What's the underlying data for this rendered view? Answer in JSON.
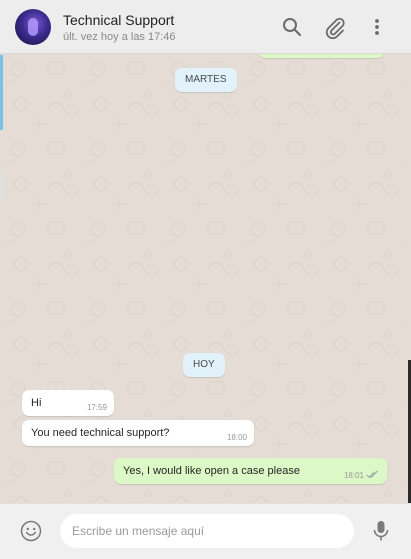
{
  "header": {
    "contact_name": "Technical Support",
    "contact_status": "últ. vez hoy a las 17:46",
    "icons": [
      "search-icon",
      "attach-icon",
      "menu-icon"
    ]
  },
  "chat": {
    "date_separators": [
      "MARTES",
      "HOY"
    ],
    "messages": [
      {
        "direction": "incoming",
        "text": "Hi",
        "time": "17:59"
      },
      {
        "direction": "incoming",
        "text": "You need technical support?",
        "time": "18:00"
      },
      {
        "direction": "outgoing",
        "text": "Yes, I would like open a case please",
        "time": "18:01",
        "status": "read"
      }
    ]
  },
  "composer": {
    "placeholder": "Escribe un mensaje aquí",
    "value": "",
    "icons": [
      "emoji-icon",
      "microphone-icon"
    ]
  },
  "colors": {
    "chat_bg": "#e5ddd5",
    "outgoing_bubble": "#dcf8c6",
    "incoming_bubble": "#ffffff",
    "date_chip": "#e1f2fb",
    "read_ticks": "#4fc3f7"
  }
}
